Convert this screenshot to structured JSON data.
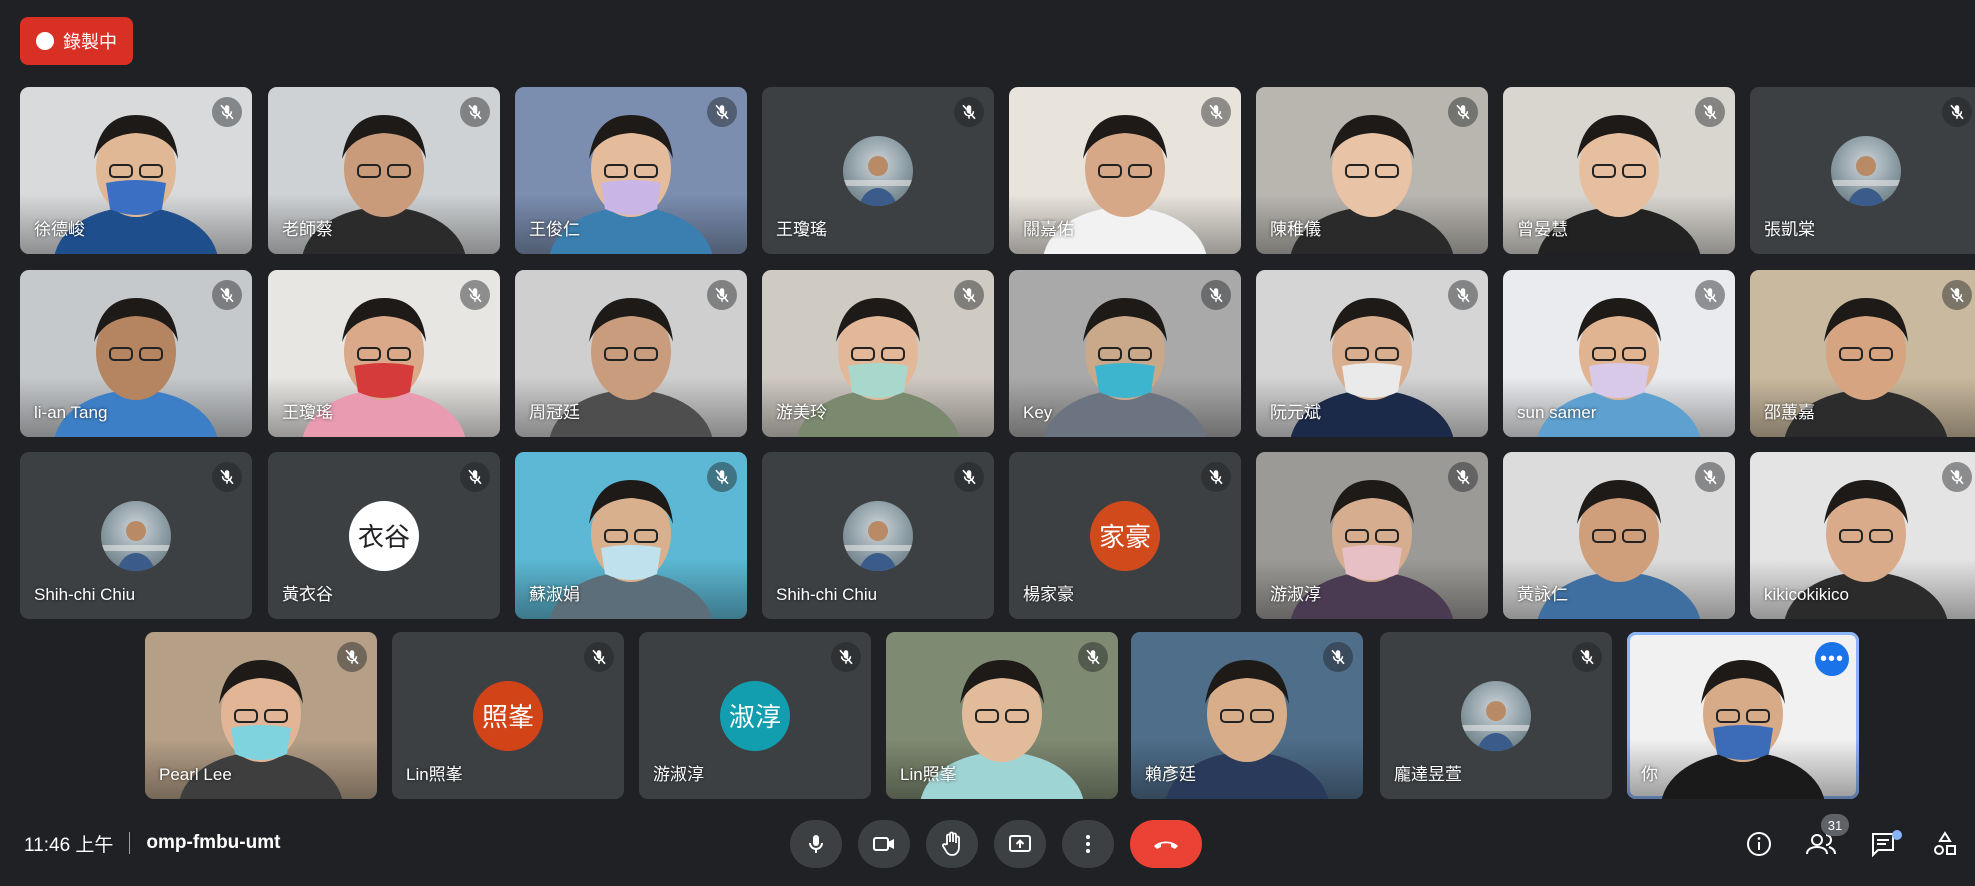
{
  "recording": {
    "label": "錄製中"
  },
  "participants": [
    {
      "name": "徐德峻",
      "kind": "video",
      "bg": "#d8dadc",
      "skin": "#e0b896",
      "shirt": "#1f4e8c",
      "mask": "#3a6fc4",
      "col": 0,
      "row": 0
    },
    {
      "name": "老師蔡",
      "kind": "video",
      "bg": "#cfd2d4",
      "skin": "#c99b7a",
      "shirt": "#2b2b2b",
      "col": 1,
      "row": 0
    },
    {
      "name": "王俊仁",
      "kind": "video",
      "bg": "#7b8eb0",
      "skin": "#e4bc9c",
      "shirt": "#3b7fb0",
      "mask": "#c9b6e6",
      "col": 2,
      "row": 0
    },
    {
      "name": "王瓊瑤",
      "kind": "avatar-photo",
      "col": 3,
      "row": 0
    },
    {
      "name": "關嘉佑",
      "kind": "video",
      "bg": "#e8e4dc",
      "skin": "#d7a887",
      "shirt": "#f2f2f2",
      "col": 4,
      "row": 0
    },
    {
      "name": "陳稚儀",
      "kind": "video",
      "bg": "#b9b6b0",
      "skin": "#e9c3a5",
      "shirt": "#2a2a2a",
      "col": 5,
      "row": 0
    },
    {
      "name": "曾晏慧",
      "kind": "video",
      "bg": "#d9d6d0",
      "skin": "#e6bfa0",
      "shirt": "#222",
      "col": 6,
      "row": 0
    },
    {
      "name": "張凱棠",
      "kind": "avatar-photo",
      "col": 7,
      "row": 0
    },
    {
      "name": "li-an Tang",
      "kind": "video",
      "bg": "#c6c9cc",
      "skin": "#b58461",
      "shirt": "#3d7fc6",
      "col": 0,
      "row": 1
    },
    {
      "name": "王瓊瑤",
      "kind": "video",
      "bg": "#e7e6e3",
      "skin": "#d9a98a",
      "shirt": "#e99cb1",
      "mask": "#d63b3b",
      "col": 1,
      "row": 1
    },
    {
      "name": "周冠廷",
      "kind": "video",
      "bg": "#cfcfcf",
      "skin": "#c89c7c",
      "shirt": "#4e4e4e",
      "col": 2,
      "row": 1
    },
    {
      "name": "游美玲",
      "kind": "video",
      "bg": "#cfcac2",
      "skin": "#e2b898",
      "shirt": "#7b8a6e",
      "mask": "#a8d8cb",
      "col": 3,
      "row": 1
    },
    {
      "name": "Key",
      "kind": "video",
      "bg": "#a9a9a9",
      "skin": "#caa88a",
      "shirt": "#6b7480",
      "mask": "#3db5cf",
      "col": 4,
      "row": 1
    },
    {
      "name": "阮元斌",
      "kind": "video",
      "bg": "#d5d5d5",
      "skin": "#d9ae8f",
      "shirt": "#1c2a4a",
      "mask": "#eaeaea",
      "col": 5,
      "row": 1
    },
    {
      "name": "sun samer",
      "kind": "video",
      "bg": "#e9ebee",
      "skin": "#e0b490",
      "shirt": "#5ea0d0",
      "mask": "#d9c9e8",
      "col": 6,
      "row": 1
    },
    {
      "name": "邵蕙嘉",
      "kind": "video",
      "bg": "#c9b99e",
      "skin": "#d6a481",
      "shirt": "#2c2c2c",
      "col": 7,
      "row": 1
    },
    {
      "name": "Shih-chi Chiu",
      "kind": "avatar-photo",
      "col": 0,
      "row": 2
    },
    {
      "name": "黃衣谷",
      "kind": "avatar-letter",
      "letter": "衣谷",
      "avatarColor": "#ffffff",
      "letterColor": "#202124",
      "col": 1,
      "row": 2
    },
    {
      "name": "蘇淑娟",
      "kind": "video",
      "bg": "#5cb8d4",
      "skin": "#d9b08e",
      "shirt": "#5c6e7a",
      "mask": "#bfe1ee",
      "col": 2,
      "row": 2
    },
    {
      "name": "Shih-chi Chiu",
      "kind": "avatar-photo",
      "col": 3,
      "row": 2
    },
    {
      "name": "楊家豪",
      "kind": "avatar-letter",
      "letter": "家豪",
      "avatarColor": "#d14a1c",
      "letterColor": "#ffffff",
      "col": 4,
      "row": 2
    },
    {
      "name": "游淑淳",
      "kind": "video",
      "bg": "#9b9a97",
      "skin": "#d6ad8e",
      "shirt": "#4a3b52",
      "mask": "#e7c0c6",
      "col": 5,
      "row": 2
    },
    {
      "name": "黃詠仁",
      "kind": "video",
      "bg": "#dcdcdc",
      "skin": "#cf9e7b",
      "shirt": "#3f6fa0",
      "col": 6,
      "row": 2
    },
    {
      "name": "kikicokikico",
      "kind": "video",
      "bg": "#e4e4e4",
      "skin": "#d9ab8b",
      "shirt": "#2b2b2b",
      "col": 7,
      "row": 2
    },
    {
      "name": "Pearl Lee",
      "kind": "video",
      "bg": "#b59f87",
      "skin": "#e1b596",
      "shirt": "#3e3e3e",
      "mask": "#7fd3df",
      "col": 0,
      "row": 3
    },
    {
      "name": "Lin照峯",
      "kind": "avatar-letter",
      "letter": "照峯",
      "avatarColor": "#d34318",
      "letterColor": "#ffffff",
      "col": 1,
      "row": 3
    },
    {
      "name": "游淑淳",
      "kind": "avatar-letter",
      "letter": "淑淳",
      "avatarColor": "#129eaf",
      "letterColor": "#ffffff",
      "col": 2,
      "row": 3
    },
    {
      "name": "Lin照峯",
      "kind": "video",
      "bg": "#7f8a72",
      "skin": "#e2bb9a",
      "shirt": "#9fd4d4",
      "col": 3,
      "row": 3
    },
    {
      "name": "賴彥廷",
      "kind": "video",
      "bg": "#4f6e8a",
      "skin": "#d8ad8a",
      "shirt": "#2a3a5a",
      "col": 4,
      "row": 3
    },
    {
      "name": "龐達昱萱",
      "kind": "avatar-photo",
      "col": 5,
      "row": 3
    },
    {
      "name": "你",
      "kind": "video",
      "self": true,
      "bg": "#f1f1f1",
      "skin": "#d7aa88",
      "shirt": "#1a1a1a",
      "mask": "#3c6cb8",
      "col": 6,
      "row": 3
    }
  ],
  "self_menu": {
    "label": "•••"
  },
  "bottom": {
    "time": "11:46 上午",
    "meeting_code": "omp-fmbu-umt",
    "participant_count": "31"
  },
  "colors": {
    "background": "#202124",
    "tile": "#3c4043",
    "accent": "#8ab4f8",
    "hangup": "#ea4335",
    "record": "#d93025"
  },
  "icons": [
    "microphone-icon",
    "camera-icon",
    "raise-hand-icon",
    "present-icon",
    "more-vert-icon",
    "hangup-icon",
    "info-icon",
    "people-icon",
    "chat-icon",
    "activities-icon",
    "mic-off-icon"
  ]
}
